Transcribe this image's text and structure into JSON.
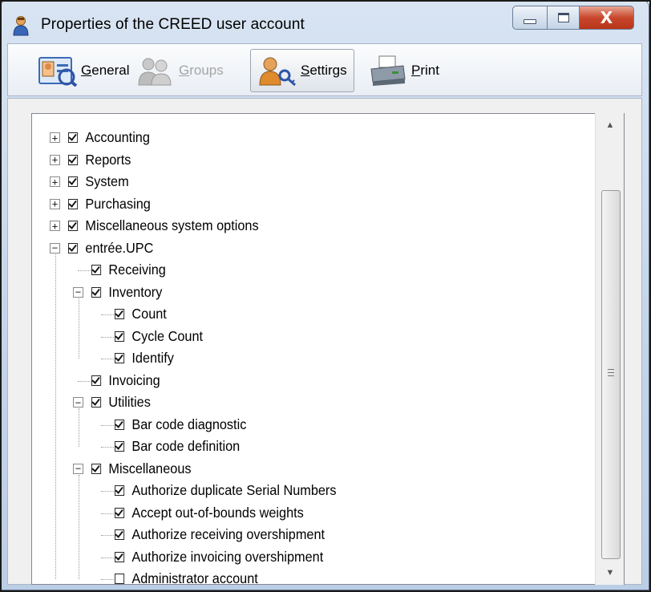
{
  "window": {
    "title": "Properties of the CREED user account",
    "close_glyph": "X"
  },
  "toolbar": {
    "buttons": [
      {
        "label": "General",
        "accel": "G",
        "rest": "eneral",
        "icon": "user-card-icon",
        "state": "normal"
      },
      {
        "label": "Groups",
        "accel": "G",
        "rest": "roups",
        "icon": "group-icon",
        "state": "disabled"
      },
      {
        "label": "Settirgs",
        "accel": "S",
        "rest": "ettirgs",
        "icon": "user-key-icon",
        "state": "active"
      },
      {
        "label": "Print",
        "accel": "P",
        "rest": "rint",
        "icon": "printer-icon",
        "state": "normal"
      }
    ]
  },
  "tree": {
    "nodes": [
      {
        "label": "Accounting",
        "checked": true,
        "expander": "+"
      },
      {
        "label": "Reports",
        "checked": true,
        "expander": "+"
      },
      {
        "label": "System",
        "checked": true,
        "expander": "+"
      },
      {
        "label": "Purchasing",
        "checked": true,
        "expander": "+"
      },
      {
        "label": "Miscellaneous system options",
        "checked": true,
        "expander": "+"
      },
      {
        "label": "entrée.UPC",
        "checked": true,
        "expander": "−"
      },
      {
        "label": "Receiving",
        "checked": true
      },
      {
        "label": "Inventory",
        "checked": true,
        "expander": "−"
      },
      {
        "label": "Count",
        "checked": true
      },
      {
        "label": "Cycle Count",
        "checked": true
      },
      {
        "label": "Identify",
        "checked": true
      },
      {
        "label": "Invoicing",
        "checked": true
      },
      {
        "label": "Utilities",
        "checked": true,
        "expander": "−"
      },
      {
        "label": "Bar code diagnostic",
        "checked": true
      },
      {
        "label": "Bar code definition",
        "checked": true
      },
      {
        "label": "Miscellaneous",
        "checked": true,
        "expander": "−"
      },
      {
        "label": "Authorize duplicate Serial Numbers",
        "checked": true
      },
      {
        "label": "Accept out-of-bounds weights",
        "checked": true
      },
      {
        "label": "Authorize receiving overshipment",
        "checked": true
      },
      {
        "label": "Authorize invoicing overshipment",
        "checked": true
      },
      {
        "label": "Administrator account",
        "checked": false
      }
    ]
  },
  "scrollbar": {
    "up_arrow": "▲",
    "down_arrow": "▼"
  },
  "colors": {
    "title_bar": "#c3d4e9",
    "close_button": "#c8482d",
    "tree_background": "#ffffff"
  }
}
